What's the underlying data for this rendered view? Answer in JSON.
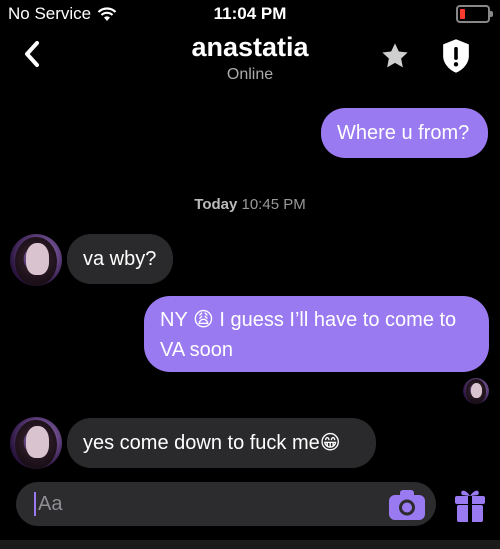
{
  "status_bar": {
    "carrier": "No Service",
    "time": "11:04 PM",
    "battery_level": 0.1
  },
  "header": {
    "title": "anastatia",
    "subtitle": "Online"
  },
  "messages": [
    {
      "direction": "outgoing",
      "text": "Where u from?"
    },
    {
      "direction": "incoming",
      "text": "va wby?"
    },
    {
      "direction": "outgoing",
      "text_line1": "NY 😩 I guess I’ll have to come to",
      "text_line2": "VA soon"
    },
    {
      "direction": "incoming",
      "text": "yes come down to fuck me😁"
    }
  ],
  "timestamp": {
    "day": "Today",
    "time": "10:45 PM"
  },
  "composer": {
    "placeholder": "Aa"
  },
  "colors": {
    "accent": "#9a7af0",
    "incoming_bubble": "#2a2a2c",
    "background": "#000000"
  }
}
